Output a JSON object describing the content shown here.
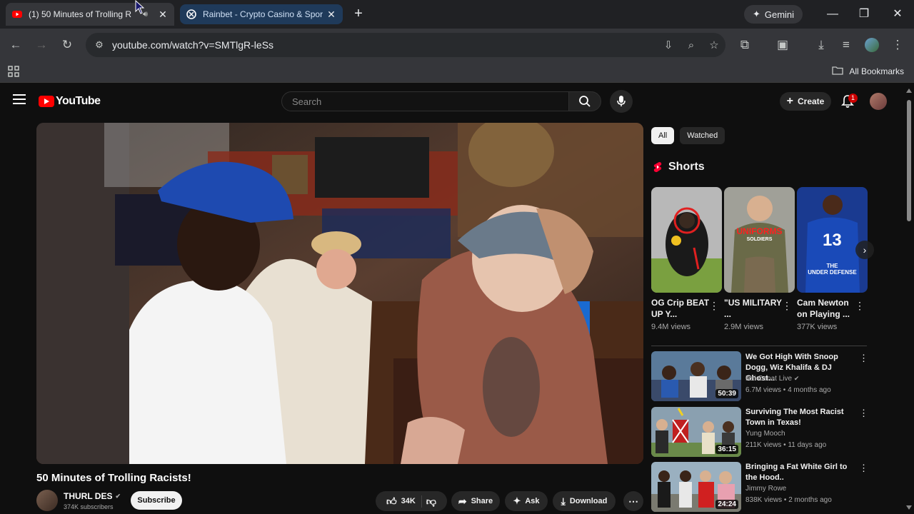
{
  "browser": {
    "tabs": [
      {
        "title": "(1) 50 Minutes of Trolling R",
        "active": true,
        "favicon": "youtube-icon"
      },
      {
        "title": "Rainbet - Crypto Casino & Spor",
        "active": false,
        "favicon": "rainbet-icon"
      }
    ],
    "gemini_label": "Gemini",
    "url": "youtube.com/watch?v=SMTlgR-leSs",
    "all_bookmarks": "All Bookmarks"
  },
  "youtube": {
    "logo_text": "YouTube",
    "search_placeholder": "Search",
    "create_label": "Create",
    "notification_count": "1"
  },
  "video": {
    "title": "50 Minutes of Trolling Racists!",
    "channel": "THURL DES",
    "subscribers": "374K subscribers",
    "subscribe_label": "Subscribe",
    "likes": "34K",
    "share_label": "Share",
    "ask_label": "Ask",
    "download_label": "Download"
  },
  "sidebar": {
    "chips": [
      "All",
      "Watched"
    ],
    "shorts_heading": "Shorts",
    "shorts": [
      {
        "title": "OG Crip BEAT UP Y...",
        "views": "9.4M views"
      },
      {
        "title": "\"US MILITARY ...",
        "views": "2.9M views"
      },
      {
        "title": "Cam Newton on Playing ...",
        "views": "377K views"
      }
    ],
    "shorts_overlays": {
      "s2_a": "UNIFORMS",
      "s2_b": "SOLDIERS",
      "s3_a": "THE",
      "s3_b": "UNDER DEFENSE"
    },
    "recommended": [
      {
        "title": "We Got High With Snoop Dogg, Wiz Khalifa & DJ Ghost...",
        "channel": "Kai Cenat Live",
        "meta": "6.7M views • 4 months ago",
        "duration": "50:39"
      },
      {
        "title": "Surviving The Most Racist Town in Texas!",
        "channel": "Yung Mooch",
        "meta": "211K views • 11 days ago",
        "duration": "36:15"
      },
      {
        "title": "Bringing a Fat White Girl to the Hood..",
        "channel": "Jimmy Rowe",
        "meta": "838K views • 2 months ago",
        "duration": "24:24"
      }
    ]
  },
  "colors": {
    "brand_red": "#ff0000",
    "background": "#0f0f0f"
  }
}
